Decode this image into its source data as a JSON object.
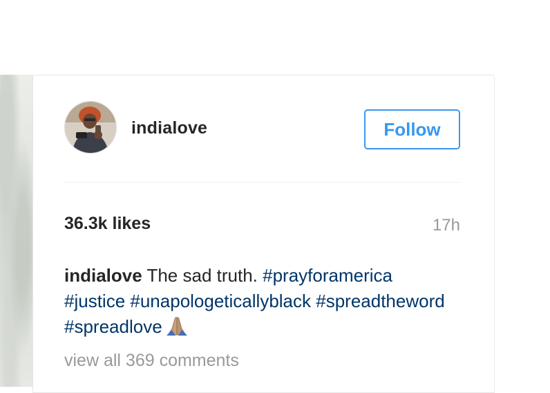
{
  "post": {
    "username": "indialove",
    "follow_label": "Follow",
    "likes": "36.3k likes",
    "time_ago": "17h",
    "caption": {
      "username": "indialove",
      "text": "The sad truth.",
      "hashtags": [
        "#prayforamerica",
        "#justice",
        "#unapologeticallyblack",
        "#spreadtheword",
        "#spreadlove"
      ],
      "emoji": "folded-hands"
    },
    "view_comments": "view all 369 comments"
  },
  "colors": {
    "accent": "#3897f0",
    "hashtag": "#003569",
    "text": "#262626",
    "muted": "#999999"
  }
}
